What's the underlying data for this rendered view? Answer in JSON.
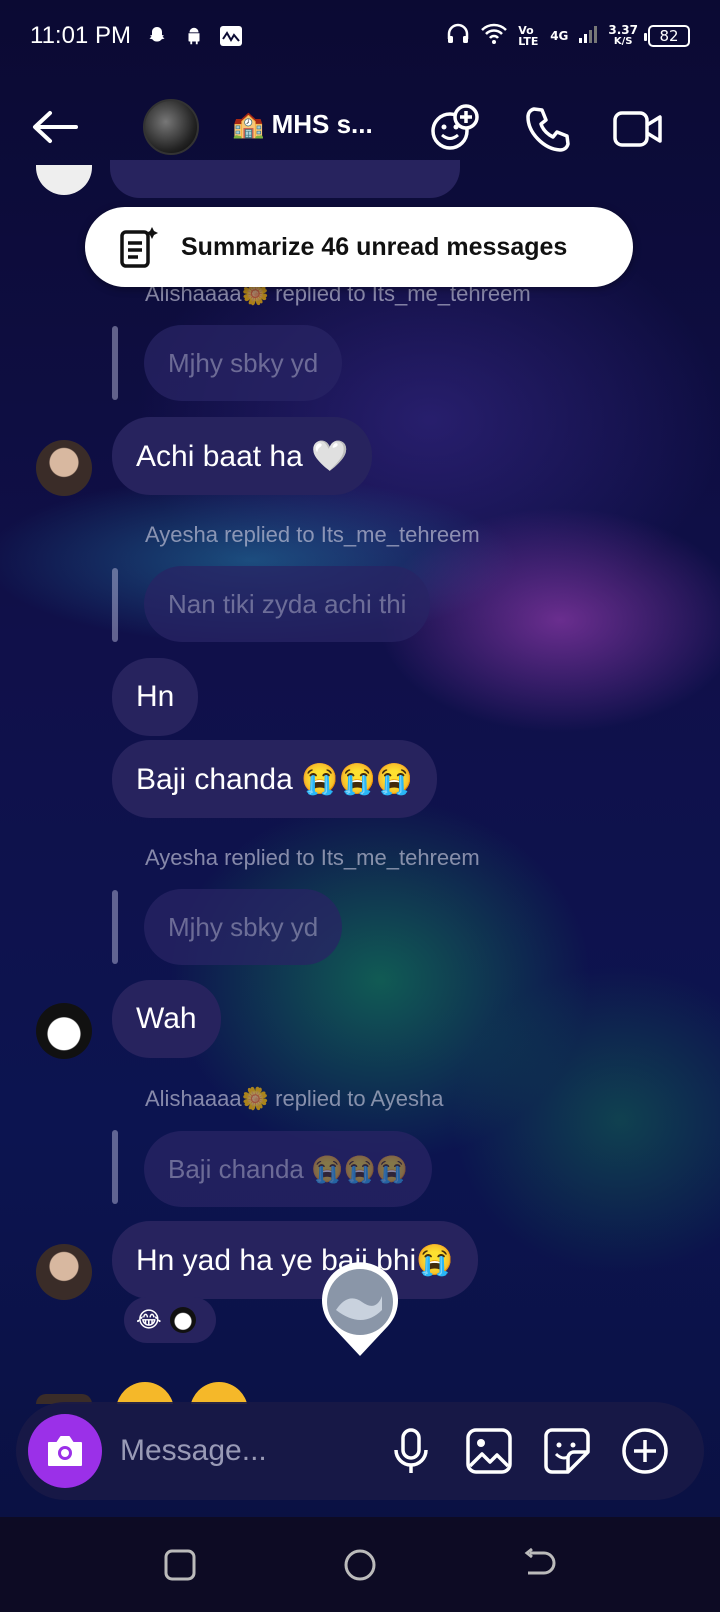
{
  "status_bar": {
    "time": "11:01 PM",
    "net_speed_value": "3.37",
    "net_speed_unit": "K/S",
    "volte": "Vo LTE",
    "network": "4G",
    "battery": "82"
  },
  "header": {
    "group_name": "🏫 MHS s..."
  },
  "summarize": {
    "label": "Summarize 46 unread messages"
  },
  "messages": [
    {
      "type": "reply_note",
      "text": "Alishaaaa🌼 replied to Its_me_tehreem"
    },
    {
      "type": "reply_quote",
      "text": "Mjhy sbky yd"
    },
    {
      "type": "message",
      "text": "Achi baat ha 🤍"
    },
    {
      "type": "reply_note",
      "text": "Ayesha replied to Its_me_tehreem"
    },
    {
      "type": "reply_quote",
      "text": "Nan tiki zyda achi thi"
    },
    {
      "type": "message",
      "text": "Hn"
    },
    {
      "type": "message",
      "text": "Baji chanda 😭😭😭"
    },
    {
      "type": "reply_note",
      "text": "Ayesha replied to Its_me_tehreem"
    },
    {
      "type": "reply_quote",
      "text": "Mjhy sbky yd"
    },
    {
      "type": "message",
      "text": "Wah"
    },
    {
      "type": "reply_note",
      "text": "Alishaaaa🌼 replied to Ayesha"
    },
    {
      "type": "reply_quote",
      "text": "Baji chanda 😭😭😭"
    },
    {
      "type": "message",
      "text": "Hn yad ha ye baji bhi😭"
    }
  ],
  "reactions": {
    "emoji": "😂"
  },
  "compose": {
    "placeholder": "Message..."
  },
  "colors": {
    "accent": "#9b30e8",
    "bubble": "#27235e"
  },
  "icons": [
    "back-arrow-icon",
    "add-people-icon",
    "phone-icon",
    "video-icon",
    "camera-icon",
    "mic-icon",
    "gallery-icon",
    "sticker-icon",
    "plus-icon",
    "recents-icon",
    "home-icon",
    "back-nav-icon"
  ]
}
